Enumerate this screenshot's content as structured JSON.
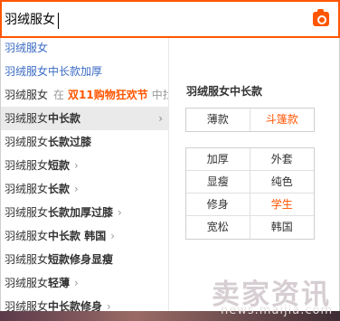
{
  "search": {
    "value": "羽绒服女",
    "camera_icon": "camera-icon"
  },
  "suggestions": [
    {
      "parts": [
        {
          "t": "羽绒服女",
          "s": "kw"
        }
      ],
      "style": "blue"
    },
    {
      "parts": [
        {
          "t": "羽绒服女中长款加厚",
          "s": "kw"
        }
      ],
      "style": "blue"
    },
    {
      "parts": [
        {
          "t": "羽绒服女",
          "s": "kw"
        },
        {
          "t": "在",
          "s": "in"
        },
        {
          "t": "双11购物狂欢节",
          "s": "promo"
        },
        {
          "t": "中找",
          "s": "trail"
        }
      ],
      "style": ""
    },
    {
      "parts": [
        {
          "t": "羽绒服女",
          "s": "kw"
        },
        {
          "t": "中长款",
          "s": "b"
        }
      ],
      "style": "active",
      "arrow": true
    },
    {
      "parts": [
        {
          "t": "羽绒服女",
          "s": "kw"
        },
        {
          "t": "长款过膝",
          "s": "b"
        }
      ],
      "style": ""
    },
    {
      "parts": [
        {
          "t": "羽绒服女",
          "s": "kw"
        },
        {
          "t": "短款",
          "s": "b"
        }
      ],
      "style": "",
      "arrow": true
    },
    {
      "parts": [
        {
          "t": "羽绒服女",
          "s": "kw"
        },
        {
          "t": "长款",
          "s": "b"
        }
      ],
      "style": "",
      "arrow": true
    },
    {
      "parts": [
        {
          "t": "羽绒服女",
          "s": "kw"
        },
        {
          "t": "长款加厚过膝",
          "s": "b"
        }
      ],
      "style": "",
      "arrow": true
    },
    {
      "parts": [
        {
          "t": "羽绒服女",
          "s": "kw"
        },
        {
          "t": "中长款 韩国",
          "s": "b"
        }
      ],
      "style": "",
      "arrow": true
    },
    {
      "parts": [
        {
          "t": "羽绒服女",
          "s": "kw"
        },
        {
          "t": "短款修身显瘦",
          "s": "b"
        }
      ],
      "style": ""
    },
    {
      "parts": [
        {
          "t": "羽绒服女",
          "s": "kw"
        },
        {
          "t": "轻薄",
          "s": "b"
        }
      ],
      "style": "",
      "arrow": true
    },
    {
      "parts": [
        {
          "t": "羽绒服女",
          "s": "kw"
        },
        {
          "t": "中长款修身",
          "s": "b"
        }
      ],
      "style": "",
      "arrow": true
    }
  ],
  "arrow_glyph": "›",
  "panel": {
    "title": "羽绒服女中长款",
    "group1": [
      {
        "label": "薄款",
        "hl": false
      },
      {
        "label": "斗篷款",
        "hl": true
      }
    ],
    "group2": [
      {
        "label": "加厚",
        "hl": false
      },
      {
        "label": "外套",
        "hl": false
      },
      {
        "label": "显瘦",
        "hl": false
      },
      {
        "label": "纯色",
        "hl": false
      },
      {
        "label": "修身",
        "hl": false
      },
      {
        "label": "学生",
        "hl": true
      },
      {
        "label": "宽松",
        "hl": false
      },
      {
        "label": "韩国",
        "hl": false
      }
    ]
  },
  "watermark": {
    "main": "卖家资讯",
    "sub": "news.maijia.com"
  },
  "colors": {
    "accent": "#ff5500",
    "link_blue": "#3c6cc4",
    "active_bg": "#eaeaea"
  }
}
